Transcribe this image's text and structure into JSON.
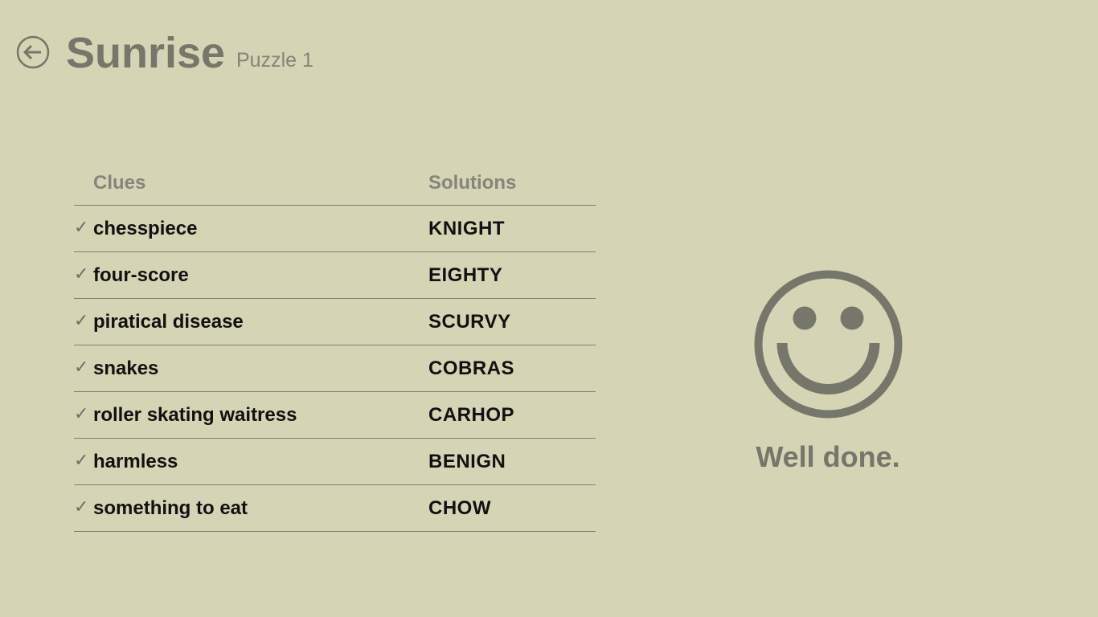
{
  "header": {
    "title": "Sunrise",
    "subtitle": "Puzzle 1",
    "back_icon": "back-arrow-icon"
  },
  "table": {
    "clues_header": "Clues",
    "solutions_header": "Solutions",
    "rows": [
      {
        "checked": true,
        "clue": "chesspiece",
        "solution": "KNIGHT"
      },
      {
        "checked": true,
        "clue": "four-score",
        "solution": "EIGHTY"
      },
      {
        "checked": true,
        "clue": "piratical disease",
        "solution": "SCURVY"
      },
      {
        "checked": true,
        "clue": "snakes",
        "solution": "COBRAS"
      },
      {
        "checked": true,
        "clue": "roller skating waitress",
        "solution": "CARHOP"
      },
      {
        "checked": true,
        "clue": "harmless",
        "solution": "BENIGN"
      },
      {
        "checked": true,
        "clue": "something to eat",
        "solution": "CHOW"
      }
    ]
  },
  "result": {
    "icon": "smiley-face-icon",
    "message": "Well done."
  },
  "colors": {
    "background": "#d5d4b5",
    "accent": "#76766a",
    "text": "#111111"
  }
}
